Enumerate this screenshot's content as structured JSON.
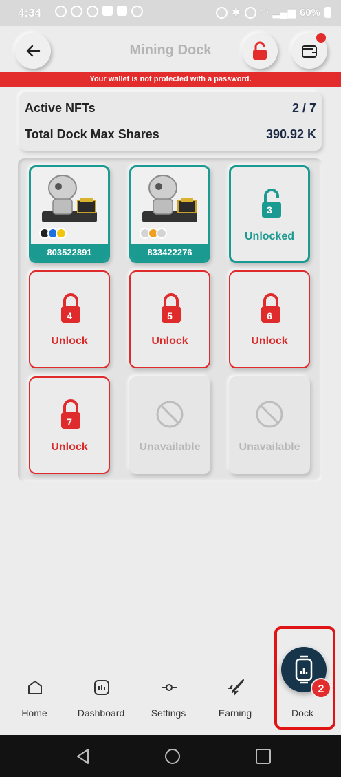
{
  "status_bar": {
    "time": "4:34",
    "battery": "60%"
  },
  "header": {
    "title": "Mining Dock"
  },
  "warning": "Your wallet is not protected with a password.",
  "stats": {
    "active_nfts_label": "Active NFTs",
    "active_nfts_value": "2 / 7",
    "max_shares_label": "Total Dock Max Shares",
    "max_shares_value": "390.92 K"
  },
  "slots": {
    "nft1": {
      "id": "803522891"
    },
    "nft2": {
      "id": "833422276"
    },
    "s3": {
      "number": "3",
      "label": "Unlocked"
    },
    "s4": {
      "number": "4",
      "label": "Unlock"
    },
    "s5": {
      "number": "5",
      "label": "Unlock"
    },
    "s6": {
      "number": "6",
      "label": "Unlock"
    },
    "s7": {
      "number": "7",
      "label": "Unlock"
    },
    "s8": {
      "label": "Unavailable"
    },
    "s9": {
      "label": "Unavailable"
    }
  },
  "nav": {
    "home": "Home",
    "dashboard": "Dashboard",
    "settings": "Settings",
    "earning": "Earning",
    "dock": "Dock",
    "dock_badge": "2"
  },
  "colors": {
    "teal": "#1a9a91",
    "red": "#e32d2d",
    "navy": "#16344a"
  }
}
